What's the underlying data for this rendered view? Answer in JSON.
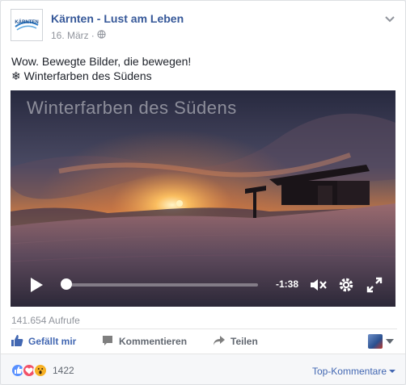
{
  "post": {
    "page_name": "Kärnten - Lust am Leben",
    "date": "16. März",
    "date_separator": "·",
    "line1": "Wow. Bewegte Bilder, die bewegen!",
    "line2": "❄ Winterfarben des Südens",
    "logo_text": "KÄRNTEN"
  },
  "video": {
    "title_overlay": "Winterfarben des Südens",
    "remaining_time": "-1:38",
    "progress": 0.0
  },
  "stats": {
    "views": "141.654 Aufrufe"
  },
  "actions": {
    "like": "Gefällt mir",
    "comment": "Kommentieren",
    "share": "Teilen"
  },
  "footer": {
    "reaction_count": "1422",
    "sort_label": "Top-Kommentare",
    "reactions": [
      "like",
      "love",
      "wow"
    ]
  },
  "colors": {
    "link_blue": "#365899",
    "action_blue": "#4267b2",
    "like_icon": "#5890ff",
    "love_icon": "#f25268",
    "wow_icon": "#f7b125"
  }
}
